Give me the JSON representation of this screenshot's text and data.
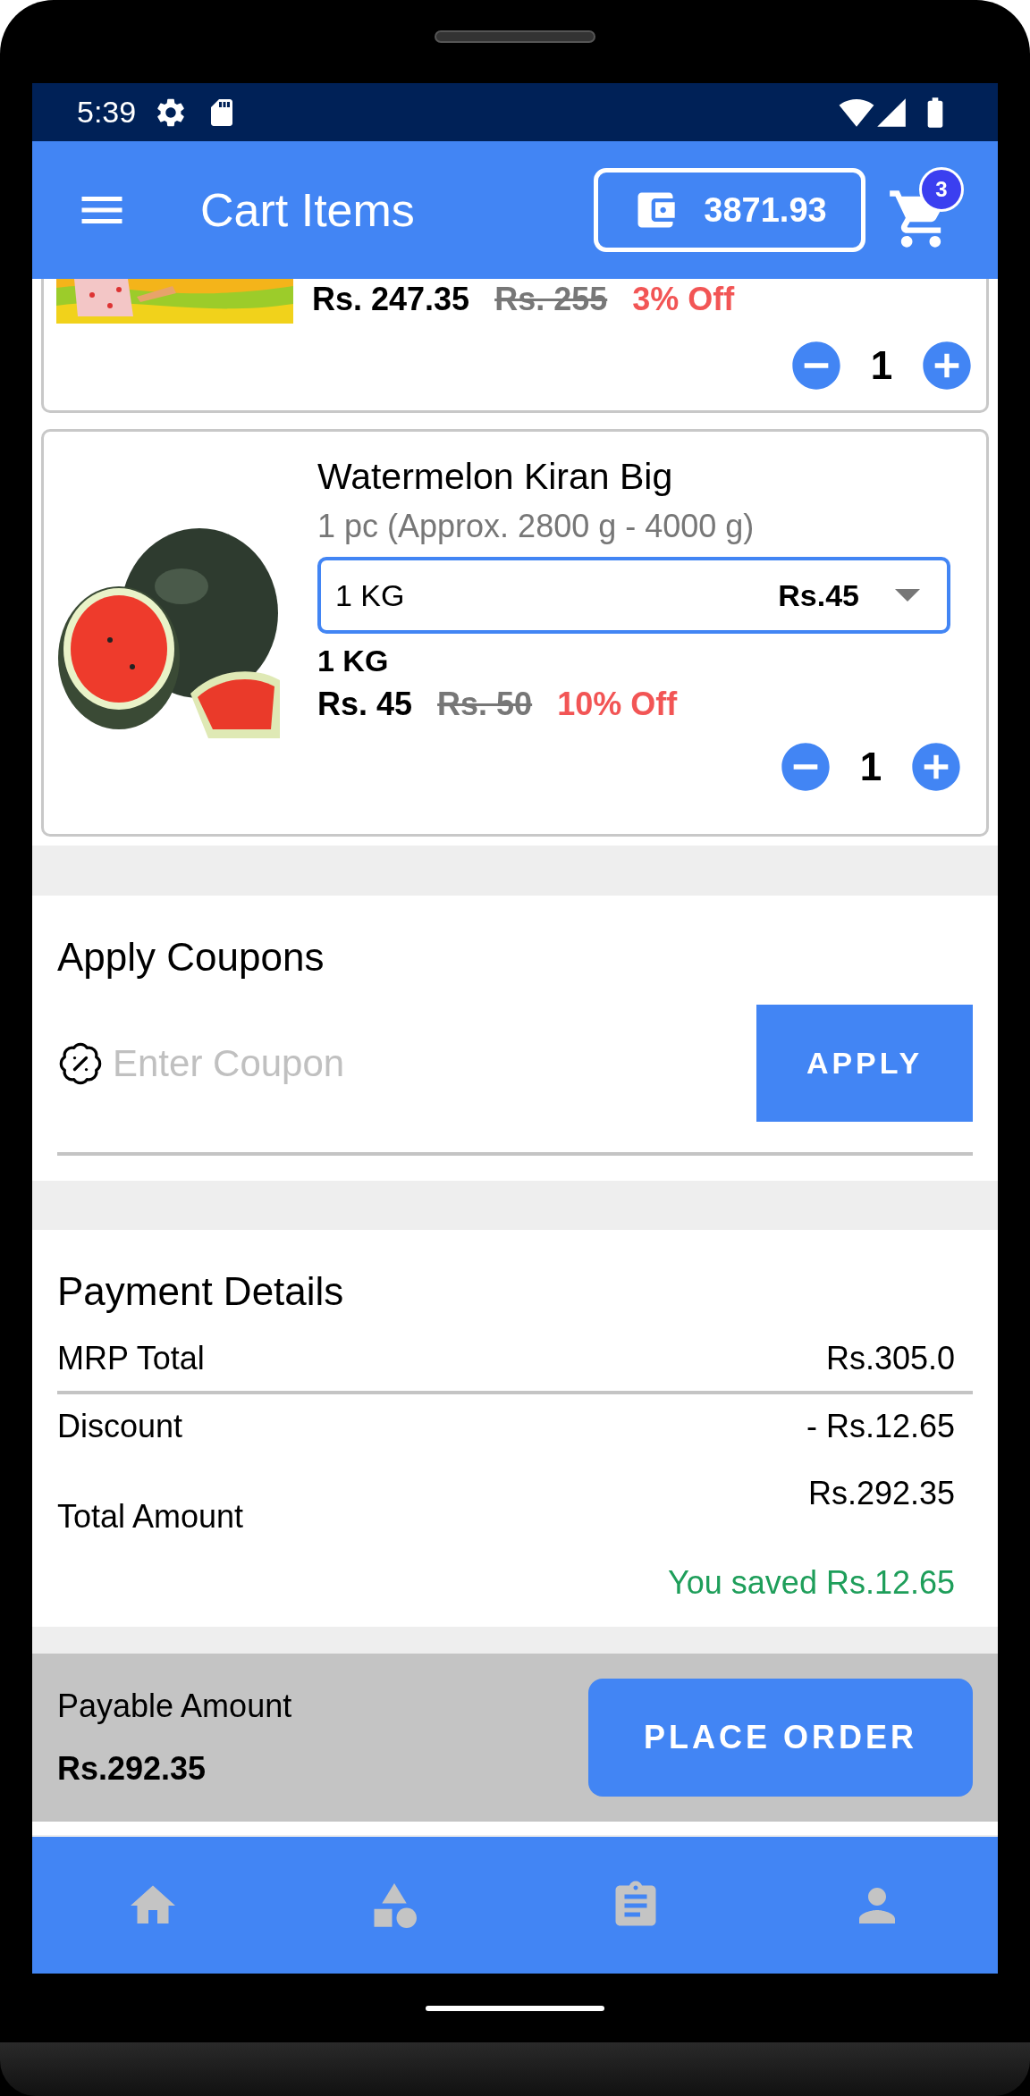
{
  "status_bar": {
    "time": "5:39"
  },
  "app_bar": {
    "title": "Cart Items",
    "wallet_balance": "3871.93",
    "cart_badge": "3"
  },
  "cart_items": [
    {
      "kind": "partial",
      "price": "Rs. 247.35",
      "mrp": "Rs. 255",
      "discount": "3% Off",
      "quantity": "1"
    },
    {
      "kind": "full",
      "name": "Watermelon Kiran Big",
      "pack_info": "1 pc (Approx. 2800 g - 4000 g)",
      "variant_select": {
        "label": "1 KG",
        "price": "Rs.45"
      },
      "variant": "1 KG",
      "price": "Rs. 45",
      "mrp": "Rs. 50",
      "discount": "10% Off",
      "quantity": "1"
    }
  ],
  "coupons": {
    "title": "Apply Coupons",
    "placeholder": "Enter Coupon",
    "button": "APPLY"
  },
  "payment": {
    "title": "Payment Details",
    "rows": [
      {
        "label": "MRP Total",
        "value": "Rs.305.0"
      },
      {
        "label": "Discount",
        "value": "- Rs.12.65"
      },
      {
        "label": "Total Amount",
        "value": "Rs.292.35"
      }
    ],
    "savings": "You saved Rs.12.65"
  },
  "footer": {
    "label": "Payable Amount",
    "amount": "Rs.292.35",
    "button": "PLACE ORDER"
  }
}
